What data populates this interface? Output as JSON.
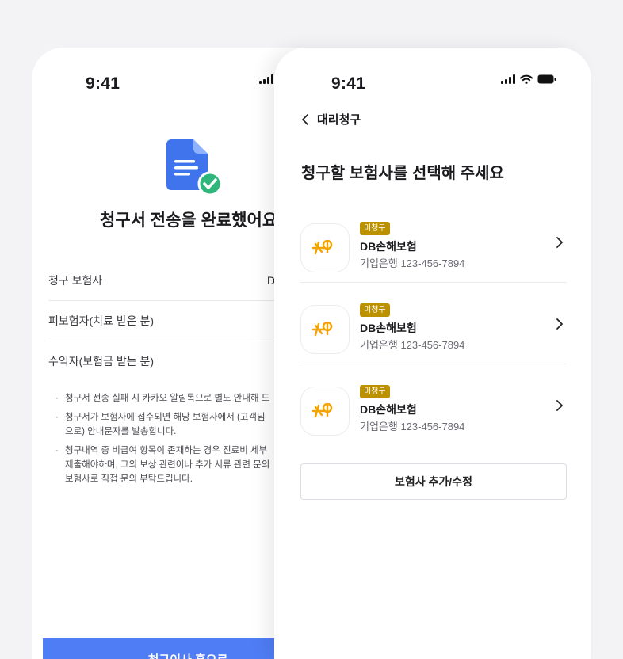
{
  "left_screen": {
    "status": {
      "time": "9:41"
    },
    "title": "청구서 전송을 완료했어요",
    "rows": [
      {
        "label": "청구 보험사",
        "value": "D"
      },
      {
        "label": "피보험자(치료 받은 분)",
        "value": ""
      },
      {
        "label": "수익자(보험금 받는 분)",
        "value": ""
      }
    ],
    "notes": [
      "청구서 전송 실패 시 카카오 알림톡으로 별도 안내해 드",
      "청구서가 보험사에 접수되면 해당 보험사에서 (고객님\n으로) 안내문자를 발송합니다.",
      "청구내역 중 비급여 항목이 존재하는 경우 진료비 세부\n제출해야하며, 그외 보상 관련이나 추가 서류 관련 문의\n보험사로 직접 문의 부탁드립니다."
    ],
    "bottom_button": "청구이사 홈으로"
  },
  "right_screen": {
    "status": {
      "time": "9:41"
    },
    "back_label": "대리청구",
    "heading": "청구할 보험사를 선택해 주세요",
    "items": [
      {
        "badge": "미청구",
        "name": "DB손해보험",
        "account": "기업은행 123-456-7894"
      },
      {
        "badge": "미청구",
        "name": "DB손해보험",
        "account": "기업은행 123-456-7894"
      },
      {
        "badge": "미청구",
        "name": "DB손해보험",
        "account": "기업은행 123-456-7894"
      }
    ],
    "add_button": "보험사 추가/수정"
  },
  "colors": {
    "primary": "#4f7df5",
    "badge": "#bb9100",
    "logo": "#f5a300",
    "check": "#2fb77b"
  }
}
